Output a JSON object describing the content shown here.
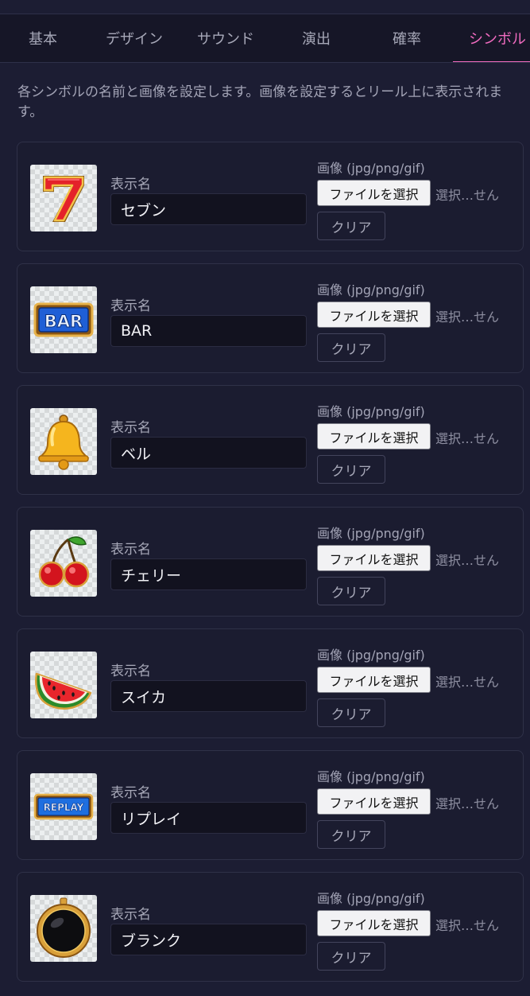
{
  "tabs": [
    {
      "label": "基本"
    },
    {
      "label": "デザイン"
    },
    {
      "label": "サウンド"
    },
    {
      "label": "演出"
    },
    {
      "label": "確率"
    },
    {
      "label": "シンボル"
    }
  ],
  "active_tab": "シンボル",
  "description": "各シンボルの名前と画像を設定します。画像を設定するとリール上に表示されます。",
  "symbols": [
    {
      "name_label": "表示名",
      "name_value": "セブン",
      "image_label": "画像 (jpg/png/gif)",
      "file_button": "ファイルを選択",
      "file_status": "選択…せん",
      "clear_button": "クリア",
      "icon": "seven-icon"
    },
    {
      "name_label": "表示名",
      "name_value": "BAR",
      "image_label": "画像 (jpg/png/gif)",
      "file_button": "ファイルを選択",
      "file_status": "選択…せん",
      "clear_button": "クリア",
      "icon": "bar-icon",
      "icon_text": "BAR"
    },
    {
      "name_label": "表示名",
      "name_value": "ベル",
      "image_label": "画像 (jpg/png/gif)",
      "file_button": "ファイルを選択",
      "file_status": "選択…せん",
      "clear_button": "クリア",
      "icon": "bell-icon"
    },
    {
      "name_label": "表示名",
      "name_value": "チェリー",
      "image_label": "画像 (jpg/png/gif)",
      "file_button": "ファイルを選択",
      "file_status": "選択…せん",
      "clear_button": "クリア",
      "icon": "cherry-icon"
    },
    {
      "name_label": "表示名",
      "name_value": "スイカ",
      "image_label": "画像 (jpg/png/gif)",
      "file_button": "ファイルを選択",
      "file_status": "選択…せん",
      "clear_button": "クリア",
      "icon": "watermelon-icon"
    },
    {
      "name_label": "表示名",
      "name_value": "リプレイ",
      "image_label": "画像 (jpg/png/gif)",
      "file_button": "ファイルを選択",
      "file_status": "選択…せん",
      "clear_button": "クリア",
      "icon": "replay-icon",
      "icon_text": "REPLAY"
    },
    {
      "name_label": "表示名",
      "name_value": "ブランク",
      "image_label": "画像 (jpg/png/gif)",
      "file_button": "ファイルを選択",
      "file_status": "選択…せん",
      "clear_button": "クリア",
      "icon": "blank-icon"
    }
  ],
  "colors": {
    "background": "#1c1d33",
    "tab_bar": "#161627",
    "accent": "#f06bbf",
    "card_border": "#2f3148",
    "input_bg": "#12121f"
  }
}
